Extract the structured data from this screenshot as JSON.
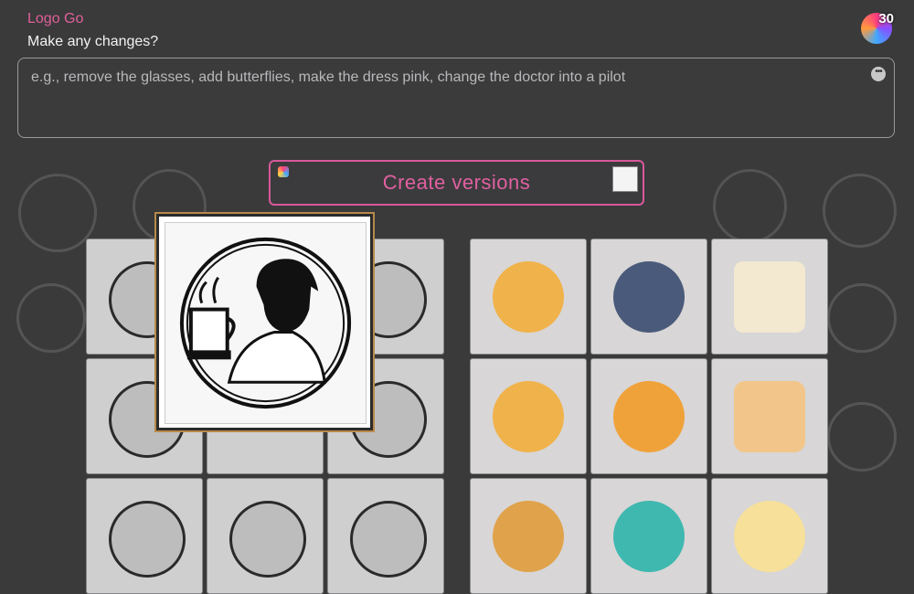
{
  "app": {
    "title": "Logo Go"
  },
  "prompt": {
    "label": "Make any changes?",
    "placeholder": "e.g., remove the glasses, add butterflies, make the dress pink, change the doctor into a pilot"
  },
  "credits": {
    "count": "30",
    "icon": "avatar-credits-icon"
  },
  "actions": {
    "create_label": "Create versions"
  },
  "colors": {
    "accent": "#e0609a",
    "background": "#3a3a3b"
  },
  "results": {
    "left_grid": [
      {
        "name": "girl-cap-bw"
      },
      {
        "name": "hidden"
      },
      {
        "name": "coffee-cup-bw"
      },
      {
        "name": "boy-coffee-bw"
      },
      {
        "name": "hidden"
      },
      {
        "name": "espresso-cup-bw"
      },
      {
        "name": "girl-coffee-bw"
      },
      {
        "name": "boy-cup-bw"
      },
      {
        "name": "cup-outline-bw"
      }
    ],
    "right_grid": [
      {
        "name": "anime-girl-barista-color"
      },
      {
        "name": "girl-cap-color"
      },
      {
        "name": "kawaii-cup-color"
      },
      {
        "name": "maid-girl-color"
      },
      {
        "name": "girl-mug-color"
      },
      {
        "name": "latte-mug-color"
      },
      {
        "name": "chibi-girl-color"
      },
      {
        "name": "orange-hair-girl-color"
      },
      {
        "name": "cup-face-color"
      }
    ]
  }
}
